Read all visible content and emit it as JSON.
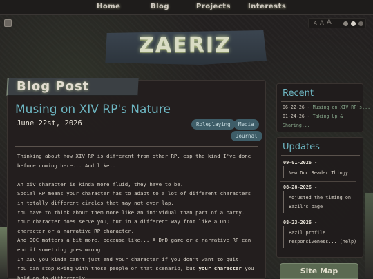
{
  "nav": {
    "items": [
      {
        "label": "Home"
      },
      {
        "label": "Blog"
      },
      {
        "label": "Projects"
      },
      {
        "label": "Interests"
      }
    ]
  },
  "font_size": {
    "small": "A",
    "medium": "A",
    "large": "A"
  },
  "logo": {
    "text": "ZAERIZ"
  },
  "banner": {
    "text": "Blog Post"
  },
  "post": {
    "title": "Musing on XIV RP's Nature",
    "date": "June 22st, 2026",
    "tags": [
      "Roleplaying",
      "Media",
      "Journal"
    ],
    "body": [
      "Thinking about how XIV RP is different from other RP, esp the kind I've done before coming here... And like...",
      "",
      "An xiv character is kinda more fluid, they have to be.",
      "Social RP means your character has to adapt to a lot of different characters in totally different circles that may not ever lap.",
      "You have to think about them more like an individual than part of a party.",
      "Your character does serve you, but in a different way from like a DnD character or a narrative RP character.",
      "And OOC matters a bit more, because like... A DnD game or a narrative RP can end if something goes wrong.",
      "In XIV you kinda can't just end your character if you don't want to quit."
    ],
    "last_line_before": "You can stop RPing with those people or that scenario, but ",
    "last_line_bold": "your character",
    "last_line_after": " you hold on to differently."
  },
  "recent": {
    "title": "Recent",
    "items": [
      {
        "date": "06-22-26",
        "sep": " - ",
        "title": "Musing on XIV RP's..."
      },
      {
        "date": "01-24-26",
        "sep": " - ",
        "title": "Taking Up &"
      },
      {
        "date": "",
        "sep": "",
        "title": "Sharing..."
      }
    ]
  },
  "updates": {
    "title": "Updates",
    "items": [
      {
        "date": "09-01-2026 -",
        "text": "New Doc Reader Thingy"
      },
      {
        "date": "08-28-2026 -",
        "text": "Adjusted the timing on Bazil's page"
      },
      {
        "date": "08-23-2026 -",
        "text": "Bazil profile responsiveness... (help)"
      }
    ]
  },
  "sitemap": {
    "label": "Site Map"
  },
  "colors": {
    "accent": "#6db5c1",
    "link": "#86a68a",
    "tag_bg": "#3e5d68"
  }
}
